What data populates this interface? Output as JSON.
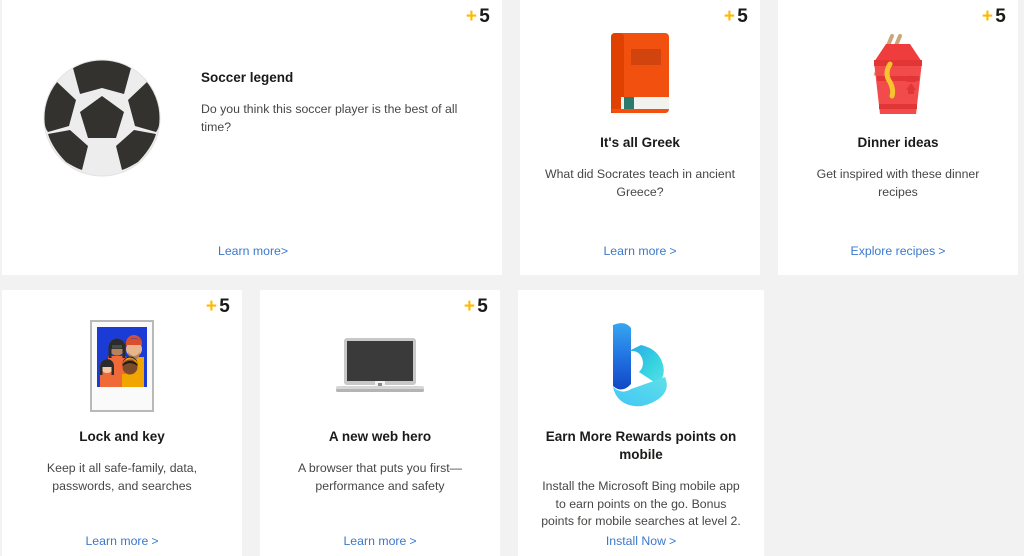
{
  "theme": {
    "page_background": "#f2f2f2",
    "card_background": "#ffffff",
    "badge_plus_color": "#ffb900",
    "badge_number_color": "#1b1a19",
    "link_color": "#3b78cc",
    "title_color": "#1b1a19",
    "description_color": "#484644"
  },
  "badges": {
    "plus": "+",
    "points": "5"
  },
  "cards": [
    {
      "id": "soccer-legend",
      "layout": "wide",
      "icon": "soccer-ball-icon",
      "badge_plus": "+",
      "badge_points": "5",
      "title": "Soccer legend",
      "description": "Do you think this soccer player is the best of all time?",
      "cta_label": "Learn more",
      "cta_chevron": ">"
    },
    {
      "id": "its-all-greek",
      "layout": "standard",
      "icon": "orange-book-icon",
      "badge_plus": "+",
      "badge_points": "5",
      "title": "It's all Greek",
      "description": "What did Socrates teach in ancient Greece?",
      "cta_label": "Learn more",
      "cta_chevron": ">"
    },
    {
      "id": "dinner-ideas",
      "layout": "standard",
      "icon": "takeout-box-icon",
      "badge_plus": "+",
      "badge_points": "5",
      "title": "Dinner ideas",
      "description": "Get inspired with these dinner recipes",
      "cta_label": "Explore recipes",
      "cta_chevron": ">"
    },
    {
      "id": "lock-and-key",
      "layout": "standard",
      "icon": "family-photo-icon",
      "badge_plus": "+",
      "badge_points": "5",
      "title": "Lock and key",
      "description": "Keep it all safe-family, data, passwords, and searches",
      "cta_label": "Learn more",
      "cta_chevron": ">"
    },
    {
      "id": "a-new-web-hero",
      "layout": "standard",
      "icon": "laptop-icon",
      "badge_plus": "+",
      "badge_points": "5",
      "title": "A new web hero",
      "description": "A browser that puts you first—performance and safety",
      "cta_label": "Learn more",
      "cta_chevron": ">"
    },
    {
      "id": "earn-more-rewards-points-on-mobile",
      "layout": "standard",
      "icon": "bing-logo-icon",
      "badge_plus": "",
      "badge_points": "",
      "title": "Earn More Rewards points on mobile",
      "description": "Install the Microsoft Bing mobile app to earn points on the go. Bonus points for mobile searches at level 2.",
      "cta_label": "Install Now",
      "cta_chevron": ">"
    }
  ]
}
